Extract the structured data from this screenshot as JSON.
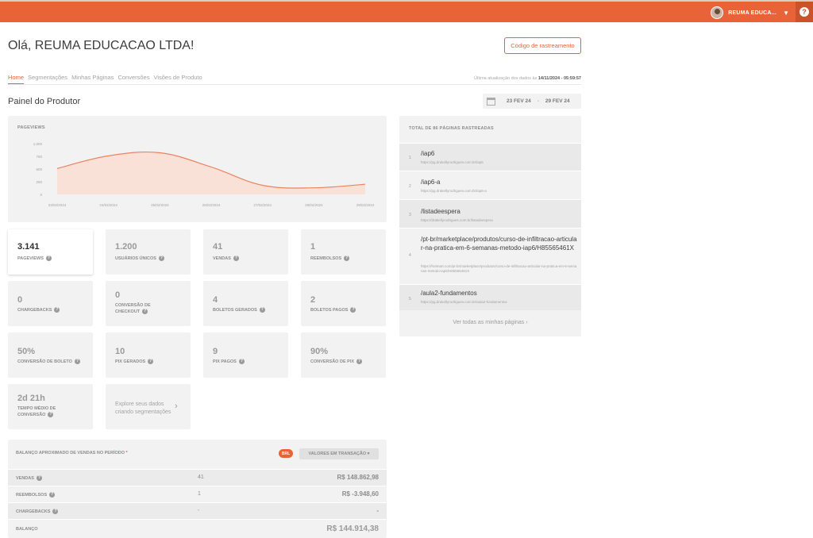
{
  "user": {
    "name": "REUMA EDUCA...",
    "help": "?"
  },
  "greeting": "Olá, REUMA EDUCACAO LTDA!",
  "tracking_button": "Código de rastreamento",
  "tabs": [
    "Home",
    "Segmentações",
    "Minhas Páginas",
    "Conversões",
    "Visões de Produto"
  ],
  "last_update": {
    "prefix": "Última atualização dos dados às",
    "value": "14/11/2024 - 05:59:57"
  },
  "panel_title": "Painel do Produtor",
  "date_range": {
    "start": "23 FEV 24",
    "sep": "-",
    "end": "29 FEV 24"
  },
  "chart_data": {
    "type": "area",
    "title": "PAGEVIEWS",
    "categories": [
      "23/02/2024",
      "24/02/2024",
      "25/02/2024",
      "26/02/2024",
      "27/02/2024",
      "28/02/2024",
      "29/02/2024"
    ],
    "series": [
      {
        "values": [
          510,
          760,
          820,
          540,
          180,
          130,
          200
        ]
      }
    ],
    "yticks": [
      1000,
      750,
      500,
      250,
      0
    ],
    "ylim": [
      0,
      1000
    ],
    "color": "#e8845f",
    "fill": "#f9e1d8"
  },
  "metrics": [
    {
      "value": "3.141",
      "label": "PAGEVIEWS",
      "help": "?"
    },
    {
      "value": "1.200",
      "label": "USUÁRIOS ÚNICOS",
      "help": "?"
    },
    {
      "value": "41",
      "label": "VENDAS",
      "help": "?"
    },
    {
      "value": "1",
      "label": "REEMBOLSOS",
      "help": "?"
    },
    {
      "value": "0",
      "label": "CHARGEBACKS",
      "help": "?"
    },
    {
      "value": "0",
      "label_line1": "CONVERSÃO DE",
      "label_line2": "CHECKOUT",
      "help": "?"
    },
    {
      "value": "4",
      "label": "BOLETOS GERADOS",
      "help": "?"
    },
    {
      "value": "2",
      "label": "BOLETOS PAGOS",
      "help": "?"
    },
    {
      "value": "50%",
      "label": "CONVERSÃO DE BOLETO",
      "help": "?"
    },
    {
      "value": "10",
      "label": "PIX GERADOS",
      "help": "?"
    },
    {
      "value": "9",
      "label": "PIX PAGOS",
      "help": "?"
    },
    {
      "value": "90%",
      "label": "CONVERSÃO DE PIX",
      "help": "?"
    },
    {
      "value": "2d 21h",
      "label_line1": "TEMPO MÉDIO DE",
      "label_line2": "CONVERSÃO",
      "help": "?"
    }
  ],
  "explore": {
    "line1": "Explore seus dados",
    "line2": "criando segmentações",
    "arrow": "›"
  },
  "pages": {
    "title": "TOTAL DE 86 PÁGINAS RASTREADAS",
    "items": [
      {
        "n": "1",
        "path": "/iap6",
        "url": "https://pg.drakellyrodrigues.com.br/iap6"
      },
      {
        "n": "2",
        "path": "/iap6-a",
        "url": "https://pg.drakellyrodrigues.com.br/iap6-a"
      },
      {
        "n": "3",
        "path": "/listadeespera",
        "url": "https://drakellyrodrigues.com.br/listadeespera"
      },
      {
        "n": "4",
        "path": "/pt-br/marketplace/produtos/curso-de-infiltracao-articular-na-pratica-em-6-semanas-metodo-iap6/H85565461X",
        "url": "https://hotmart.com/pt-br/marketplace/produtos/curso-de-infiltracao-articular-na-pratica-em-6-semanas-metodo-iap6/H85565461X"
      },
      {
        "n": "5",
        "path": "/aula2-fundamentos",
        "url": "https://pg.drakellyrodrigues.com.br/aula2-fundamentos"
      }
    ],
    "see_all": "Ver todas as minhas páginas",
    "see_all_arrow": "›"
  },
  "balance": {
    "title": "BALANÇO APROXIMADO DE VENDAS NO PERÍODO",
    "star": "*",
    "currency": "BRL",
    "dropdown": "VALORES EM TRANSAÇÃO ▾",
    "rows": [
      {
        "label": "VENDAS",
        "count": "41",
        "amount": "R$ 148.862,98"
      },
      {
        "label": "REEMBOLSOS",
        "count": "1",
        "amount": "R$ -3.948,60"
      },
      {
        "label": "CHARGEBACKS",
        "count": "-",
        "amount": "-"
      }
    ],
    "total": {
      "label": "BALANÇO",
      "amount": "R$ 144.914,38"
    }
  }
}
